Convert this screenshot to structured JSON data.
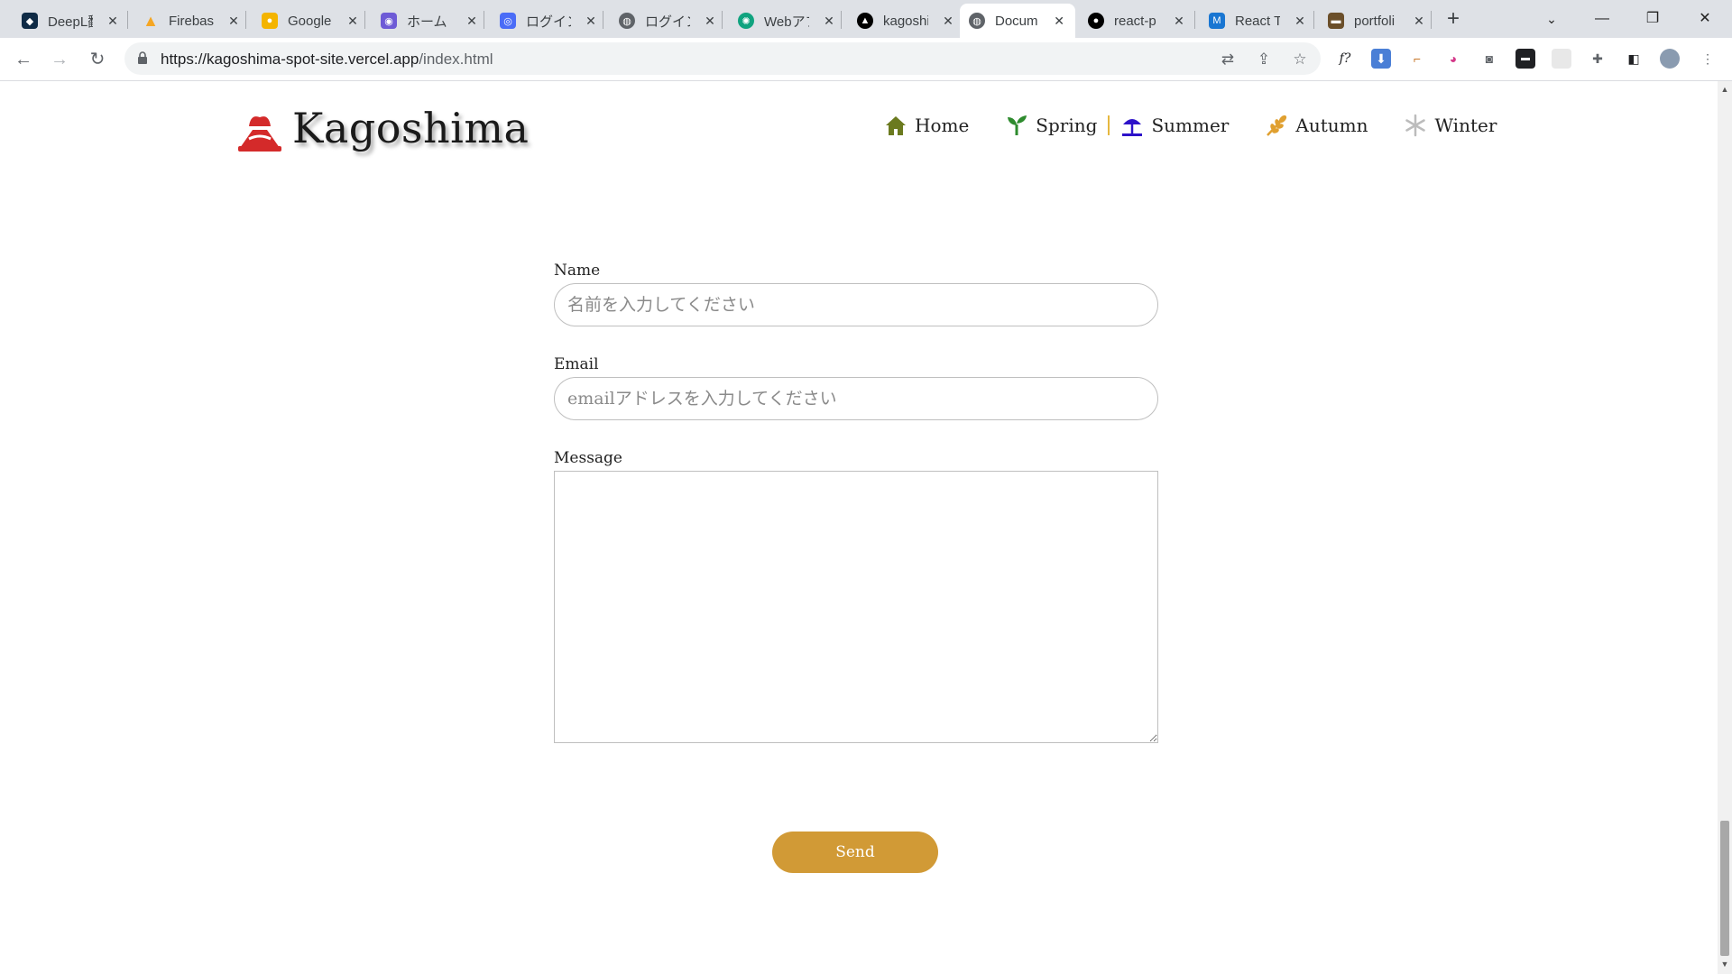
{
  "browser": {
    "tabs": [
      {
        "title": "DeepL翻",
        "icon": "deepl-icon",
        "color": "#0f2b46"
      },
      {
        "title": "Firebase",
        "icon": "firebase-icon",
        "color": "#f5a623"
      },
      {
        "title": "Google",
        "icon": "google-keep-icon",
        "color": "#f4b400"
      },
      {
        "title": "ホーム | N",
        "icon": "notion-like-icon",
        "color": "#6e5bd6"
      },
      {
        "title": "ログイン画",
        "icon": "login-app-icon",
        "color": "#4a6cf7"
      },
      {
        "title": "ログイン|",
        "icon": "globe-icon",
        "color": "#5f6368"
      },
      {
        "title": "Webアプ",
        "icon": "chatgpt-icon",
        "color": "#10a37f"
      },
      {
        "title": "kagoshi",
        "icon": "vercel-icon",
        "color": "#000000"
      },
      {
        "title": "Docum",
        "icon": "globe-icon",
        "color": "#5f6368"
      },
      {
        "title": "react-p",
        "icon": "github-icon",
        "color": "#000000"
      },
      {
        "title": "React T",
        "icon": "mui-icon",
        "color": "#1976d2"
      },
      {
        "title": "portfoli",
        "icon": "portfolio-icon",
        "color": "#6b4f2a"
      }
    ],
    "active_tab": 8,
    "url_host": "https://kagoshima-spot-site.vercel.app",
    "url_rest": "/index.html"
  },
  "site": {
    "logo_text": "Kagoshima",
    "nav": [
      {
        "label": "Home",
        "icon": "home-icon",
        "color": "#6b7a1f"
      },
      {
        "label": "Spring",
        "icon": "sprout-icon",
        "color": "#2e8b2e"
      },
      {
        "label": "Summer",
        "icon": "beach-umbrella-icon",
        "color": "#2d12c9"
      },
      {
        "label": "Autumn",
        "icon": "wheat-icon",
        "color": "#e0a030"
      },
      {
        "label": "Winter",
        "icon": "snowflake-icon",
        "color": "#bcbcbc"
      }
    ]
  },
  "form": {
    "name_label": "Name",
    "name_placeholder": "名前を入力してください",
    "email_label": "Email",
    "email_placeholder": "emailアドレスを入力してください",
    "message_label": "Message",
    "send_label": "Send"
  },
  "colors": {
    "send_button": "#d19a36",
    "logo_red": "#d42a2a"
  }
}
